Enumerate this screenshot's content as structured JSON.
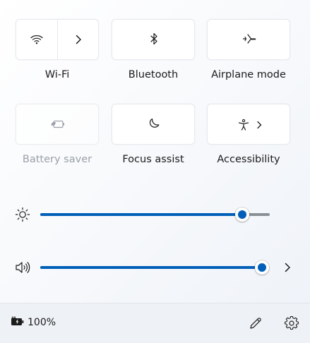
{
  "quick_settings": {
    "tiles": [
      {
        "label": "Wi-Fi",
        "icon": "wifi-icon",
        "expand_icon": "chevron-right-icon",
        "active": false
      },
      {
        "label": "Bluetooth",
        "icon": "bluetooth-icon",
        "active": false
      },
      {
        "label": "Airplane mode",
        "icon": "airplane-icon",
        "active": false
      },
      {
        "label": "Battery saver",
        "icon": "battery-saver-icon",
        "disabled": true
      },
      {
        "label": "Focus assist",
        "icon": "moon-icon",
        "active": false
      },
      {
        "label": "Accessibility",
        "icon": "accessibility-icon",
        "expand_icon": "chevron-right-icon"
      }
    ]
  },
  "sliders": {
    "brightness": {
      "icon": "brightness-icon",
      "level": 0.88
    },
    "volume": {
      "icon": "speaker-icon",
      "level": 1.0,
      "expand_icon": "chevron-right-icon"
    }
  },
  "footer": {
    "battery_icon": "battery-charging-icon",
    "battery_percent": "100%",
    "edit_icon": "pencil-icon",
    "settings_icon": "gear-icon"
  },
  "colors": {
    "accent": "#005fb8",
    "track_inactive": "#8a8f96",
    "disabled_text": "#9aa0a8"
  }
}
